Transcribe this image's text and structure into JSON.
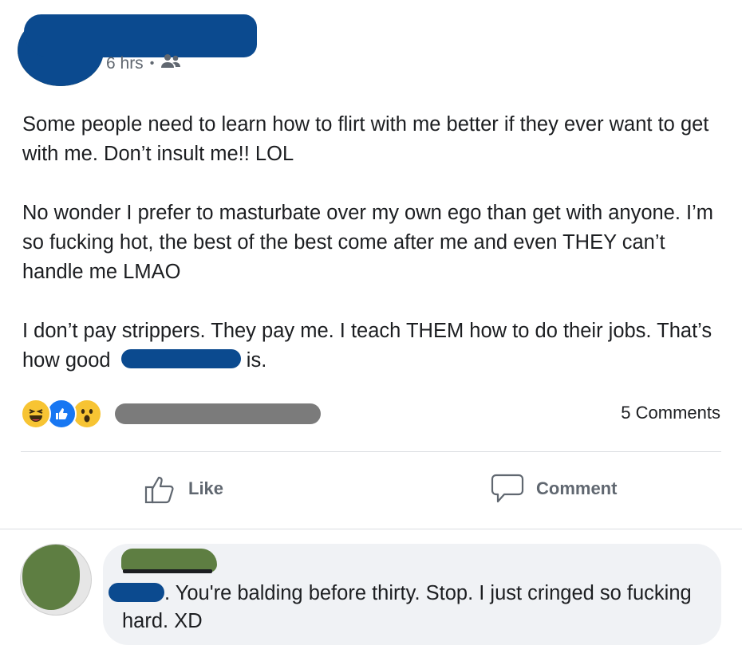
{
  "post": {
    "time": "6 hrs",
    "separator": "•",
    "audience_icon": "friends-icon",
    "paragraphs": [
      "Some people need to learn how to flirt with me better if they ever want to get with me.  Don’t insult me!! LOL",
      "No wonder I prefer to masturbate over my own ego than get with anyone.  I’m so fucking hot, the best of the best come after me and even THEY can’t handle me LMAO"
    ],
    "paragraph3_before": "I don’t pay strippers.  They pay me.  I teach THEM how to do their jobs.  That’s how good",
    "paragraph3_after": " is."
  },
  "reactions": {
    "icons": [
      "haha-reaction-icon",
      "like-reaction-icon",
      "wow-reaction-icon"
    ],
    "comments_count": "5 Comments"
  },
  "actions": {
    "like_label": "Like",
    "comment_label": "Comment"
  },
  "comment": {
    "text_after_redaction": ". You're balding before thirty. Stop. I just cringed so fucking hard. XD"
  },
  "colors": {
    "redaction_blue": "#0b4a8f",
    "redaction_gray": "#7b7b7b",
    "avatar_green": "#5e7e42",
    "bubble_bg": "#f0f2f5",
    "like_blue": "#1877f2"
  }
}
